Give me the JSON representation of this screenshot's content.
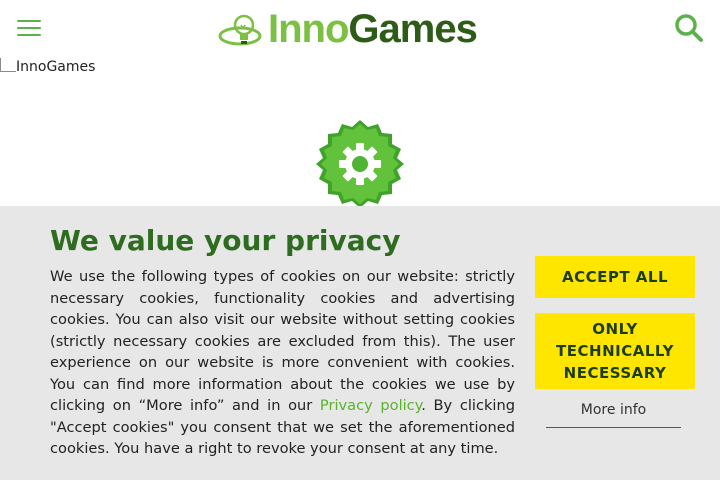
{
  "header": {
    "logo_inno": "Inno",
    "logo_games": "Games"
  },
  "broken_image": {
    "alt": "InnoGames"
  },
  "cookie_banner": {
    "title": "We value your privacy",
    "text_before_link": "We use the following types of cookies on our website: strictly necessary cookies, functionality cookies and advertising cookies. You can also visit our website without setting cookies (strictly necessary cookies are excluded from this). The user experience on our website is more convenient with cookies. You can find more information about the cookies we use by clicking on “More info” and in our ",
    "link_text": "Privacy policy",
    "text_after_link": ". By clicking \"Accept cookies\" you consent that we set the aforementioned cookies. You have a right to revoke your consent at any time.",
    "accept_all_label": "ACCEPT ALL",
    "only_necessary_label": "ONLY TECHNICALLY NECESSARY",
    "more_info_label": "More info"
  },
  "colors": {
    "brand_green": "#5bb24a",
    "title_green": "#2e6c1f",
    "button_yellow": "#ffe600",
    "banner_bg": "#e7e7e7"
  },
  "icons": {
    "menu": "hamburger-icon",
    "search": "search-icon",
    "loading": "gear-icon",
    "logo": "lightbulb-logo-icon"
  }
}
